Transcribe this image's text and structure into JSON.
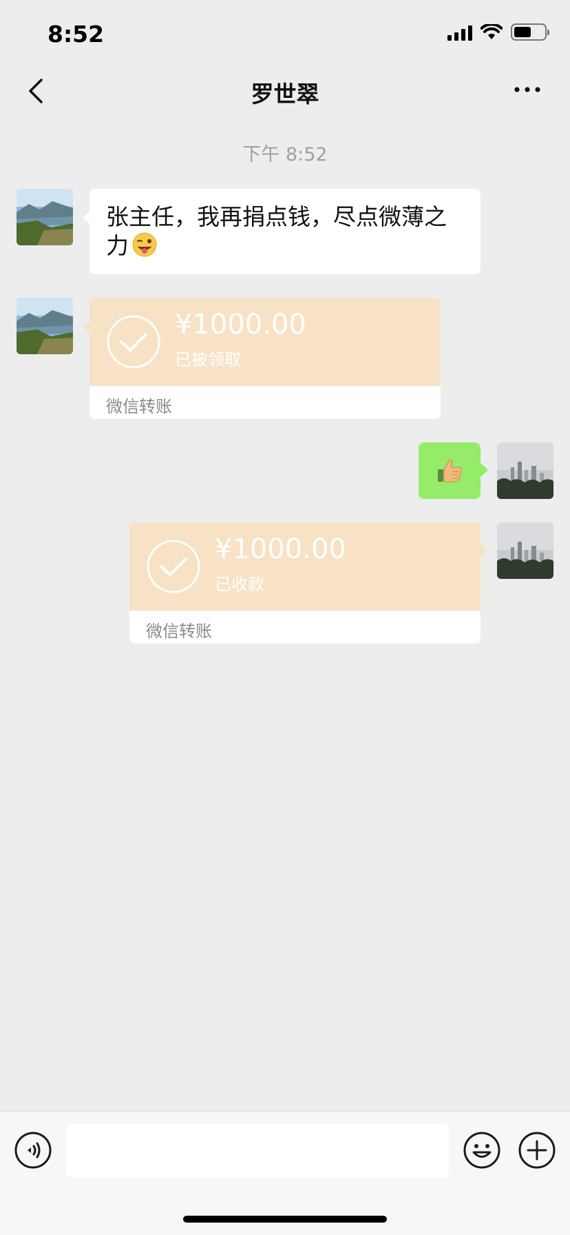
{
  "status_bar": {
    "time": "8:52"
  },
  "nav": {
    "title": "罗世翠",
    "back_icon": "chevron-left-icon",
    "more_icon": "ellipsis-icon"
  },
  "chat": {
    "timestamp": "下午 8:52",
    "messages": [
      {
        "side": "left",
        "type": "text",
        "text": "张主任，我再捐点钱，尽点微薄之力",
        "emoji": "winking-face-tongue-icon"
      },
      {
        "side": "left",
        "type": "transfer",
        "amount": "¥1000.00",
        "status": "已被领取",
        "label": "微信转账"
      },
      {
        "side": "right",
        "type": "emoji",
        "emoji": "thumbs-up-icon"
      },
      {
        "side": "right",
        "type": "transfer",
        "amount": "¥1000.00",
        "status": "已收款",
        "label": "微信转账"
      }
    ]
  },
  "input_bar": {
    "text_value": "",
    "icons": [
      "voice-icon",
      "emoji-icon",
      "plus-icon"
    ]
  },
  "colors": {
    "background": "#ededed",
    "bubble_self": "#95ec69",
    "bubble_other": "#ffffff",
    "transfer_card": "#f7e2c6"
  }
}
